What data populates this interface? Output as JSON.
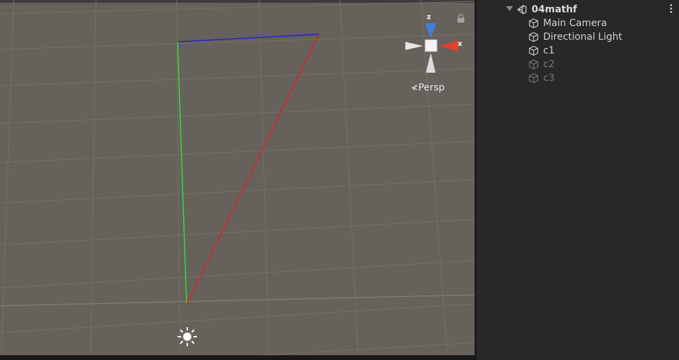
{
  "scene_view": {
    "gizmo": {
      "x_label": "x",
      "z_label": "z",
      "projection_label": "Persp",
      "x_color": "#e0402e",
      "z_color": "#3f7fe0",
      "y_color": "#dcdcdc"
    },
    "lines": [
      {
        "name": "blue-line",
        "color": "#2020e0"
      },
      {
        "name": "green-line",
        "color": "#30e030"
      },
      {
        "name": "red-line",
        "color": "#e02020"
      }
    ]
  },
  "hierarchy": {
    "scene_name": "04mathf",
    "items": [
      {
        "label": "Main Camera",
        "active": true
      },
      {
        "label": "Directional Light",
        "active": true
      },
      {
        "label": "c1",
        "active": true
      },
      {
        "label": "c2",
        "active": false
      },
      {
        "label": "c3",
        "active": false
      }
    ]
  }
}
